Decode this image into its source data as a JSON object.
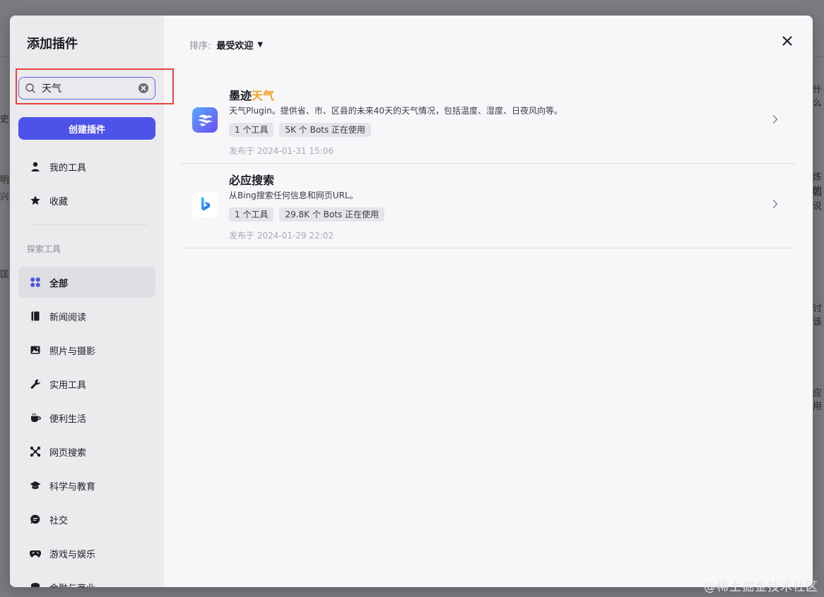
{
  "background_fragments": {
    "left": [
      "史",
      "明了",
      "兴趣",
      "匡架"
    ],
    "right": [
      "什么",
      "炼的",
      "如说",
      "讨该",
      "应用"
    ]
  },
  "modal": {
    "title": "添加插件",
    "search": {
      "value": "天气",
      "placeholder": ""
    },
    "create_button": "创建插件",
    "nav_top": [
      {
        "label": "我的工具",
        "icon": "user-icon"
      },
      {
        "label": "收藏",
        "icon": "star-icon"
      }
    ],
    "section_label": "探索工具",
    "nav_categories": [
      {
        "label": "全部",
        "icon": "grid-icon",
        "active": true
      },
      {
        "label": "新闻阅读",
        "icon": "book-icon"
      },
      {
        "label": "照片与摄影",
        "icon": "image-icon"
      },
      {
        "label": "实用工具",
        "icon": "wrench-icon"
      },
      {
        "label": "便利生活",
        "icon": "cup-icon"
      },
      {
        "label": "网页搜索",
        "icon": "network-icon"
      },
      {
        "label": "科学与教育",
        "icon": "graduation-cap-icon"
      },
      {
        "label": "社交",
        "icon": "chat-bubble-icon"
      },
      {
        "label": "游戏与娱乐",
        "icon": "gamepad-icon"
      },
      {
        "label": "金融与商业",
        "icon": "finance-icon"
      }
    ],
    "sort": {
      "label": "排序:",
      "value": "最受欢迎"
    },
    "plugins": [
      {
        "name_prefix": "墨迹",
        "name_highlight": "天气",
        "description": "天气Plugin。提供省、市、区县的未来40天的天气情况，包括温度、湿度、日夜风向等。",
        "tags": [
          "1 个工具",
          "5K 个 Bots 正在使用"
        ],
        "date": "发布于 2024-01-31 15:06",
        "icon": "moji-weather-icon"
      },
      {
        "name_prefix": "必应搜索",
        "name_highlight": "",
        "description": "从Bing搜索任何信息和网页URL。",
        "tags": [
          "1 个工具",
          "29.8K 个 Bots 正在使用"
        ],
        "date": "发布于 2024-01-29 22:02",
        "icon": "bing-icon"
      }
    ]
  },
  "watermark": "@稀土掘金技术社区",
  "colors": {
    "accent": "#4d53e8",
    "highlight": "#f2a023",
    "annotation_red": "#e8443f"
  }
}
